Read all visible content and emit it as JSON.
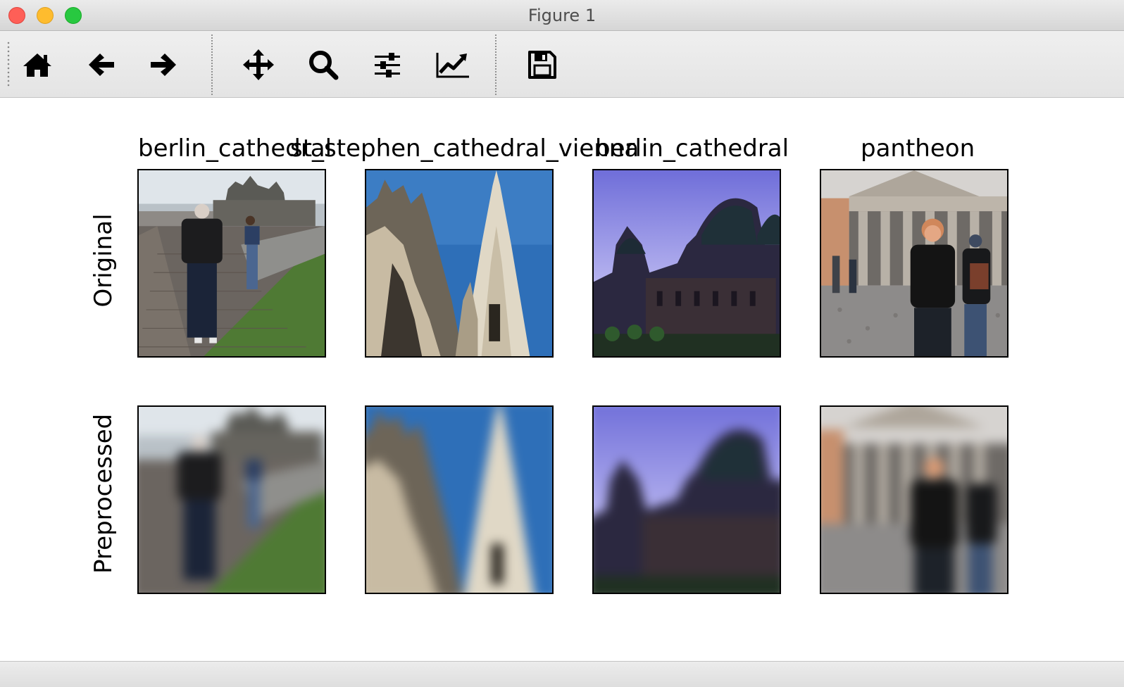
{
  "window": {
    "title": "Figure 1"
  },
  "toolbar": {
    "tools": [
      {
        "name": "home",
        "icon": "home-icon"
      },
      {
        "name": "back",
        "icon": "arrow-left-icon"
      },
      {
        "name": "forward",
        "icon": "arrow-right-icon"
      },
      {
        "name": "pan",
        "icon": "move-icon"
      },
      {
        "name": "zoom",
        "icon": "magnifier-icon"
      },
      {
        "name": "configure-subplots",
        "icon": "sliders-icon"
      },
      {
        "name": "edit-axes",
        "icon": "line-chart-icon"
      },
      {
        "name": "save",
        "icon": "floppy-disk-icon"
      }
    ]
  },
  "figure": {
    "columns": [
      {
        "title": "berlin_cathedral",
        "scene": "person walking on path in front of cathedral"
      },
      {
        "title": "st_stephen_cathedral_vienna",
        "scene": "gothic spire against blue sky"
      },
      {
        "title": "berlin_cathedral",
        "scene": "domed cathedral at dusk"
      },
      {
        "title": "pantheon",
        "scene": "two people in front of columned portico"
      }
    ],
    "rows": [
      {
        "label": "Original"
      },
      {
        "label": "Preprocessed"
      }
    ]
  },
  "colors": {
    "window_bg": "#ffffff",
    "toolbar_bg": "#e9e9e9",
    "close": "#fe5f57",
    "minimize": "#febc2e",
    "maximize": "#28c840",
    "text": "#000000"
  }
}
